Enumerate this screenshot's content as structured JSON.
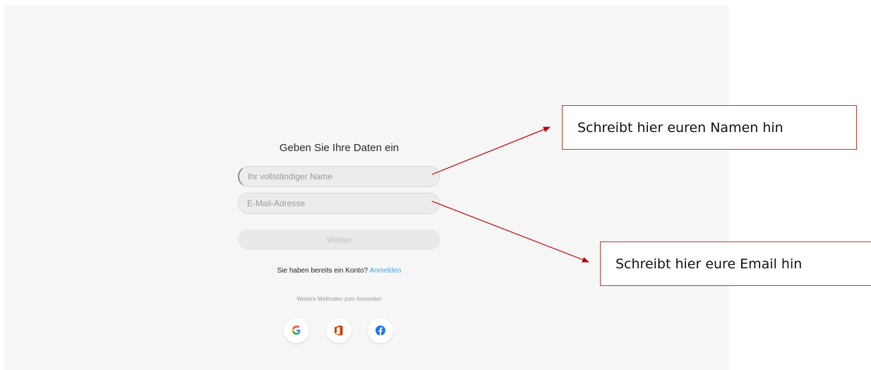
{
  "form": {
    "title": "Geben Sie Ihre Daten ein",
    "name_placeholder": "Ihr vollständiger Name",
    "email_placeholder": "E-Mail-Adresse",
    "continue_label": "Weiter",
    "have_account_text": "Sie haben bereits ein Konto?",
    "signin_link": "Anmelden",
    "more_methods_text": "Weitere Methoden zum Anmelden"
  },
  "social_icons": [
    "google-icon",
    "office-icon",
    "facebook-icon"
  ],
  "callouts": {
    "name": "Schreibt hier euren Namen hin",
    "email": "Schreibt hier eure Email hin"
  },
  "colors": {
    "panel_bg": "#f6f6f6",
    "link": "#4aa3df",
    "annotation": "#c00000",
    "google_blue": "#4285f4",
    "office_orange": "#d83b01",
    "facebook_blue": "#1877f2"
  }
}
